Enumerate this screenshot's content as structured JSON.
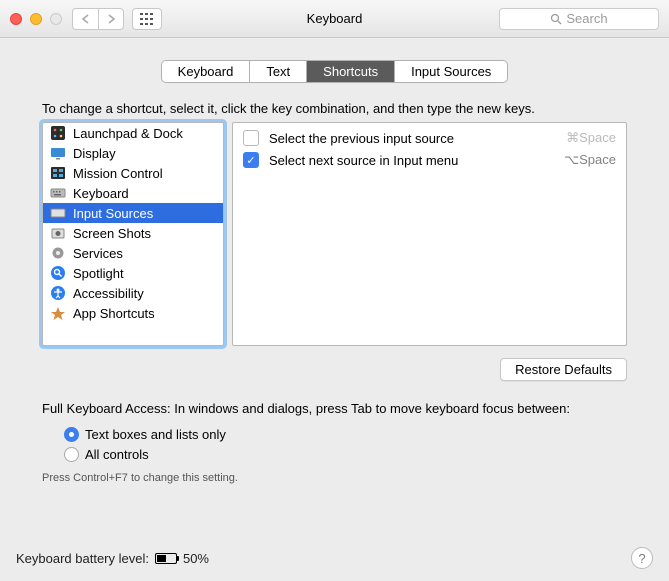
{
  "title": "Keyboard",
  "search": {
    "placeholder": "Search"
  },
  "tabs": [
    "Keyboard",
    "Text",
    "Shortcuts",
    "Input Sources"
  ],
  "active_tab_index": 2,
  "instruction": "To change a shortcut, select it, click the key combination, and then type the new keys.",
  "categories": [
    {
      "label": "Launchpad & Dock",
      "icon": "launchpad"
    },
    {
      "label": "Display",
      "icon": "display"
    },
    {
      "label": "Mission Control",
      "icon": "mission"
    },
    {
      "label": "Keyboard",
      "icon": "keyboard"
    },
    {
      "label": "Input Sources",
      "icon": "input"
    },
    {
      "label": "Screen Shots",
      "icon": "screenshot"
    },
    {
      "label": "Services",
      "icon": "services"
    },
    {
      "label": "Spotlight",
      "icon": "spotlight"
    },
    {
      "label": "Accessibility",
      "icon": "accessibility"
    },
    {
      "label": "App Shortcuts",
      "icon": "appshort"
    }
  ],
  "selected_category_index": 4,
  "shortcuts": [
    {
      "checked": false,
      "label": "Select the previous input source",
      "keys": "⌘Space"
    },
    {
      "checked": true,
      "label": "Select next source in Input menu",
      "keys": "⌥Space"
    }
  ],
  "restore_label": "Restore Defaults",
  "fka_label": "Full Keyboard Access: In windows and dialogs, press Tab to move keyboard focus between:",
  "fka_options": [
    "Text boxes and lists only",
    "All controls"
  ],
  "fka_selected_index": 0,
  "fka_hint": "Press Control+F7 to change this setting.",
  "battery": {
    "label": "Keyboard battery level:",
    "percent_text": "50%",
    "percent": 50
  }
}
